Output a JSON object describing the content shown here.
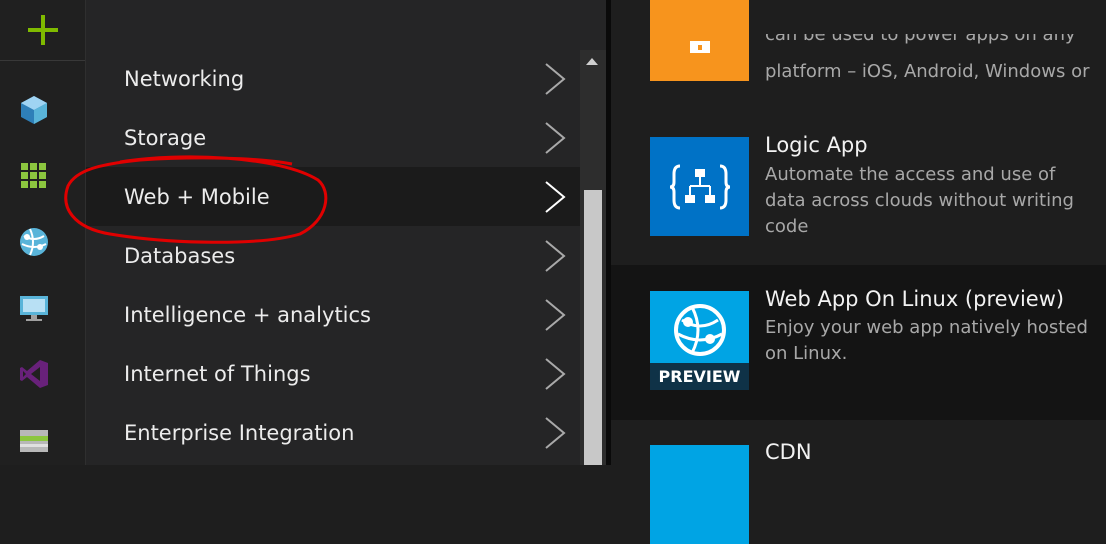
{
  "left_menu": {
    "items": [
      {
        "label": "Networking"
      },
      {
        "label": "Storage"
      },
      {
        "label": "Web + Mobile"
      },
      {
        "label": "Databases"
      },
      {
        "label": "Intelligence + analytics"
      },
      {
        "label": "Internet of Things"
      },
      {
        "label": "Enterprise Integration"
      }
    ]
  },
  "rail": {
    "icons": [
      "new-plus-icon",
      "cube-icon",
      "grid-apps-icon",
      "globe-icon",
      "monitor-icon",
      "visual-studio-icon",
      "storage-panel-icon"
    ]
  },
  "cards": [
    {
      "desc_partial_line1": "can be used to power apps on any",
      "desc_partial_line2": "platform – iOS, Android, Windows or",
      "tile_color": "#f7941d"
    },
    {
      "title": "Logic App",
      "desc": "Automate the access and use of data across clouds without writing code",
      "tile_color": "#0072c6"
    },
    {
      "title": "Web App On Linux (preview)",
      "desc": "Enjoy your web app natively hosted on Linux.",
      "badge": "PREVIEW",
      "tile_color": "#00a4e4"
    },
    {
      "title": "CDN",
      "tile_color": "#00a4e4"
    }
  ],
  "colors": {
    "accent_green": "#7fba00",
    "annotation_red": "#e00000"
  }
}
